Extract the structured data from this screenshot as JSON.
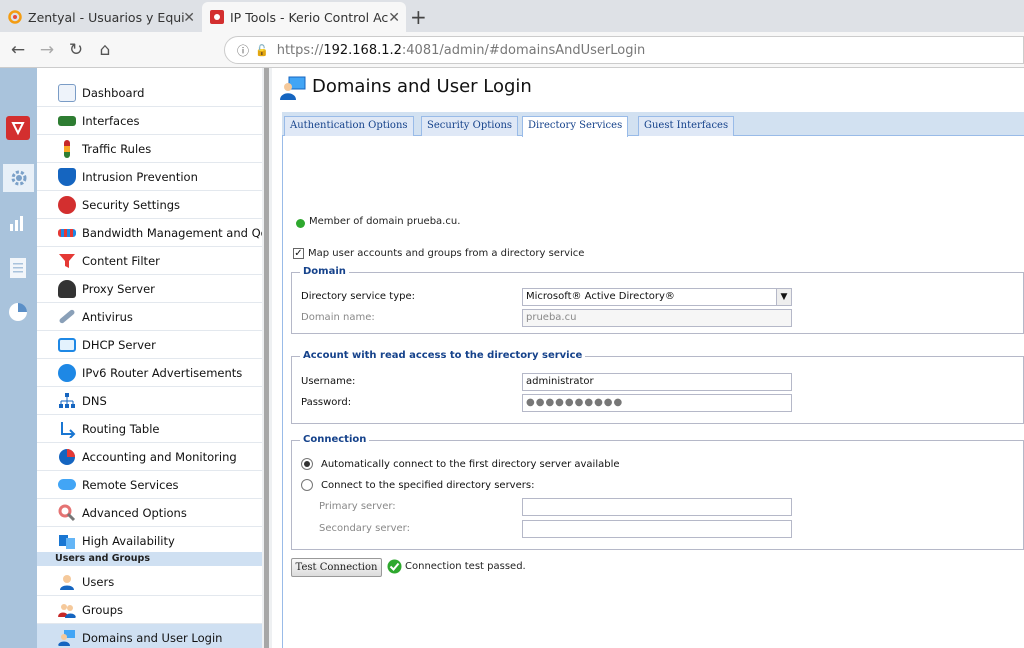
{
  "browser": {
    "tabs": [
      {
        "title": "Zentyal - Usuarios y Equi",
        "icon": "zentyal-icon"
      },
      {
        "title": "IP Tools - Kerio Control Ac",
        "icon": "kerio-icon"
      }
    ],
    "url_prefix": "https://",
    "url_host": "192.168.1.2",
    "url_rest": ":4081/admin/#domainsAndUserLogin"
  },
  "sidebar": {
    "items": [
      {
        "label": "Dashboard",
        "color": "#7a9cc6"
      },
      {
        "label": "Interfaces",
        "color": "#2e7d32"
      },
      {
        "label": "Traffic Rules",
        "color": "#c62828"
      },
      {
        "label": "Intrusion Prevention",
        "color": "#1565c0"
      },
      {
        "label": "Security Settings",
        "color": "#d32f2f"
      },
      {
        "label": "Bandwidth Management and Qo",
        "color": "#e53935"
      },
      {
        "label": "Content Filter",
        "color": "#e53935"
      },
      {
        "label": "Proxy Server",
        "color": "#333333"
      },
      {
        "label": "Antivirus",
        "color": "#8aa0b8"
      },
      {
        "label": "DHCP Server",
        "color": "#1e88e5"
      },
      {
        "label": "IPv6 Router Advertisements",
        "color": "#1e88e5"
      },
      {
        "label": "DNS",
        "color": "#1565c0"
      },
      {
        "label": "Routing Table",
        "color": "#1976d2"
      },
      {
        "label": "Accounting and Monitoring",
        "color": "#6d4c41"
      },
      {
        "label": "Remote Services",
        "color": "#42a5f5"
      },
      {
        "label": "Advanced Options",
        "color": "#e57373"
      },
      {
        "label": "High Availability",
        "color": "#1976d2"
      }
    ],
    "group_header": "Users and Groups",
    "group_items": [
      {
        "label": "Users",
        "color": "#1565c0"
      },
      {
        "label": "Groups",
        "color": "#c62828"
      },
      {
        "label": "Domains and User Login",
        "color": "#1565c0"
      }
    ]
  },
  "page": {
    "title": "Domains and User Login",
    "tabs": [
      "Authentication Options",
      "Security Options",
      "Directory Services",
      "Guest Interfaces"
    ],
    "status_text": "Member of domain prueba.cu.",
    "map_checkbox_label": "Map user accounts and groups from a directory service",
    "domain_section": {
      "legend": "Domain",
      "type_label": "Directory service type:",
      "type_value": "Microsoft® Active Directory®",
      "name_label": "Domain name:",
      "name_value": "prueba.cu"
    },
    "account_section": {
      "legend": "Account with read access to the directory service",
      "username_label": "Username:",
      "username_value": "administrator",
      "password_label": "Password:",
      "password_value": "●●●●●●●●●●"
    },
    "connection_section": {
      "legend": "Connection",
      "auto_label": "Automatically connect to the first directory server available",
      "specified_label": "Connect to the specified directory servers:",
      "primary_label": "Primary server:",
      "secondary_label": "Secondary server:"
    },
    "test_button": "Test Connection",
    "test_result": "Connection test passed."
  }
}
